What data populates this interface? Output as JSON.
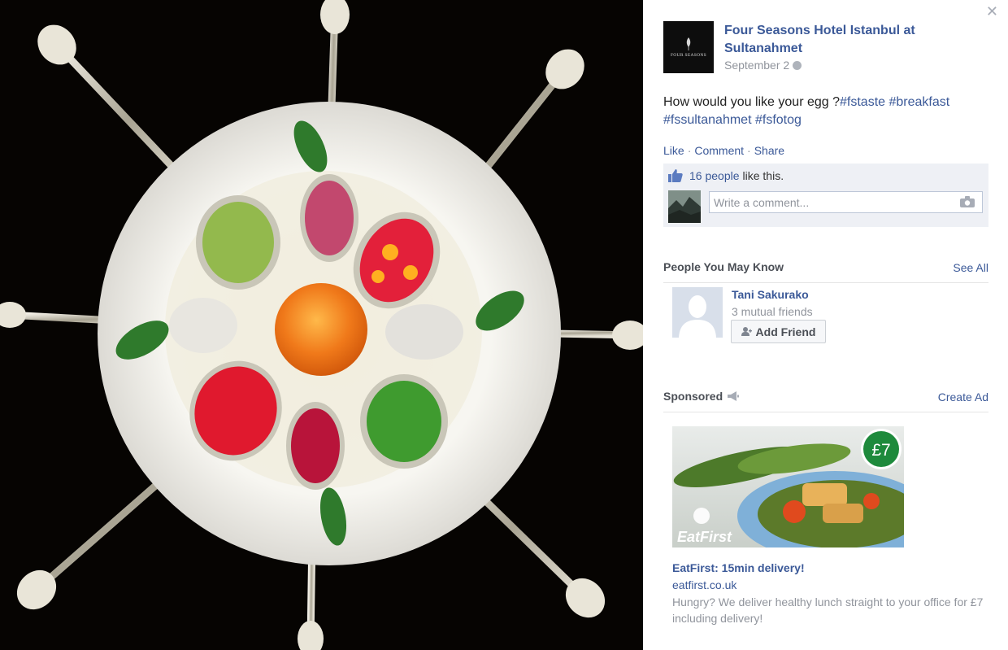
{
  "photo": {
    "alt_subject": "plate-with-spoons-photo"
  },
  "post": {
    "page_name": "Four Seasons Hotel Istanbul at Sultanahmet",
    "logo_wordmark": "FOUR SEASONS",
    "date": "September 2",
    "text_prefix": "How would you like your egg ?",
    "hashtags": [
      "#fstaste",
      "#breakfast",
      "#fssultanahmet",
      "#fsfotog"
    ],
    "actions": {
      "like": "Like",
      "comment": "Comment",
      "share": "Share"
    },
    "likes": {
      "link": "16 people",
      "suffix": "like this."
    },
    "comment_placeholder": "Write a comment..."
  },
  "pymk": {
    "title": "People You May Know",
    "see_all": "See All",
    "person": {
      "name": "Tani Sakurako",
      "mutual": "3 mutual friends",
      "add_label": "Add Friend"
    }
  },
  "sponsored": {
    "title": "Sponsored",
    "create_ad": "Create Ad",
    "ad": {
      "price_badge": "£7",
      "brand": "EatFirst",
      "title": "EatFirst: 15min delivery!",
      "domain": "eatfirst.co.uk",
      "body": "Hungry? We deliver healthy lunch straight to your office for £7 including delivery!"
    }
  },
  "colors": {
    "link": "#3b5998",
    "meta": "#90949c",
    "ufi_bg": "#eef0f5",
    "photo_bg": "#060402",
    "badge": "#1e8a3c"
  }
}
